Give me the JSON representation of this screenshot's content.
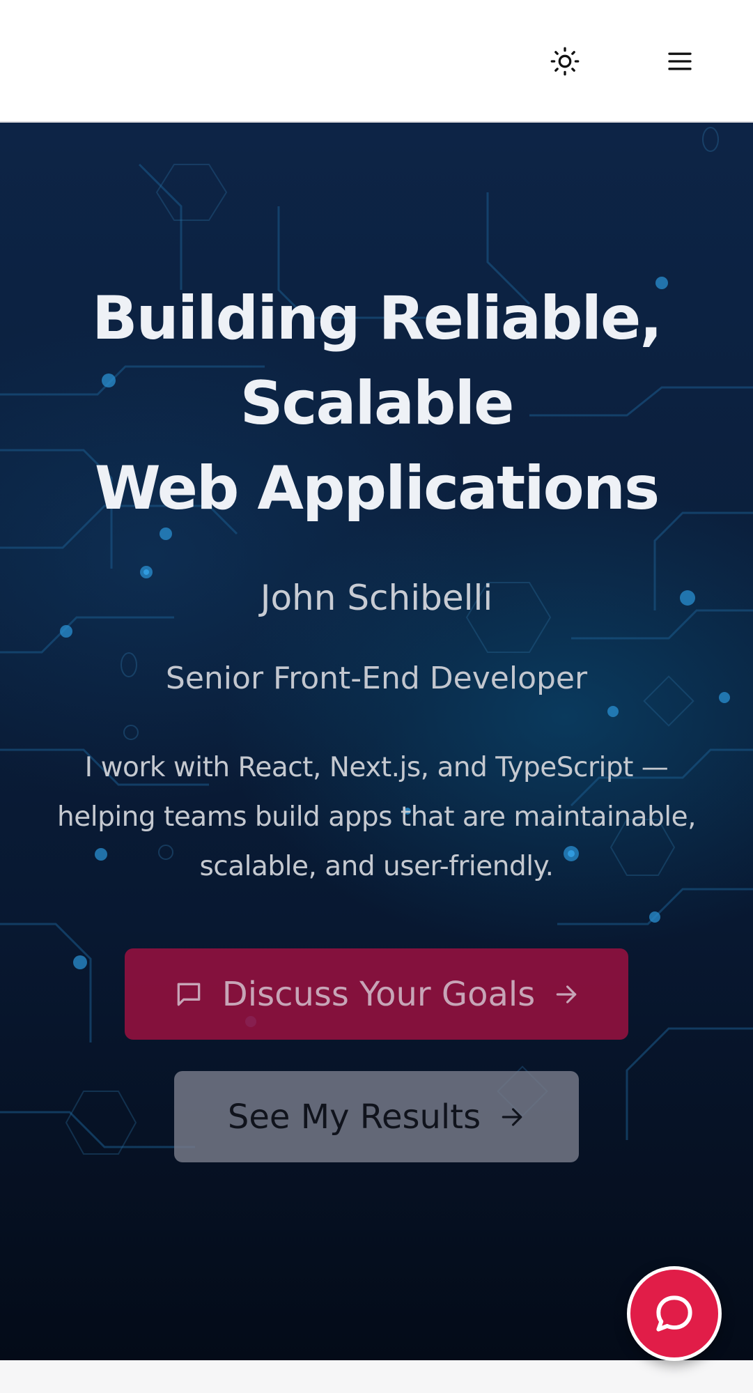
{
  "header": {
    "theme_toggle_icon": "sun-icon",
    "menu_icon": "hamburger-menu-icon"
  },
  "hero": {
    "title_lines": [
      "Building Reliable,",
      "Scalable",
      "Web Applications"
    ],
    "name": "John Schibelli",
    "role": "Senior Front-End Developer",
    "description_lines": [
      "I work with React, Next.js, and TypeScript —",
      "helping teams build apps that are maintainable,",
      "scalable, and user-friendly."
    ],
    "primary_cta": {
      "label": "Discuss Your Goals",
      "leading_icon": "message-square-icon",
      "trailing_icon": "arrow-right-icon"
    },
    "secondary_cta": {
      "label": "See My Results",
      "trailing_icon": "arrow-right-icon"
    },
    "background": "circuit-board"
  },
  "chat": {
    "icon": "chat-bubble-icon"
  },
  "colors": {
    "header_bg": "#ffffff",
    "hero_bg_dark": "#081831",
    "accent": "#e11d48",
    "primary_cta_bg": "#9a1140",
    "secondary_cta_bg": "#787b8a",
    "title_text": "#eef1f6"
  }
}
